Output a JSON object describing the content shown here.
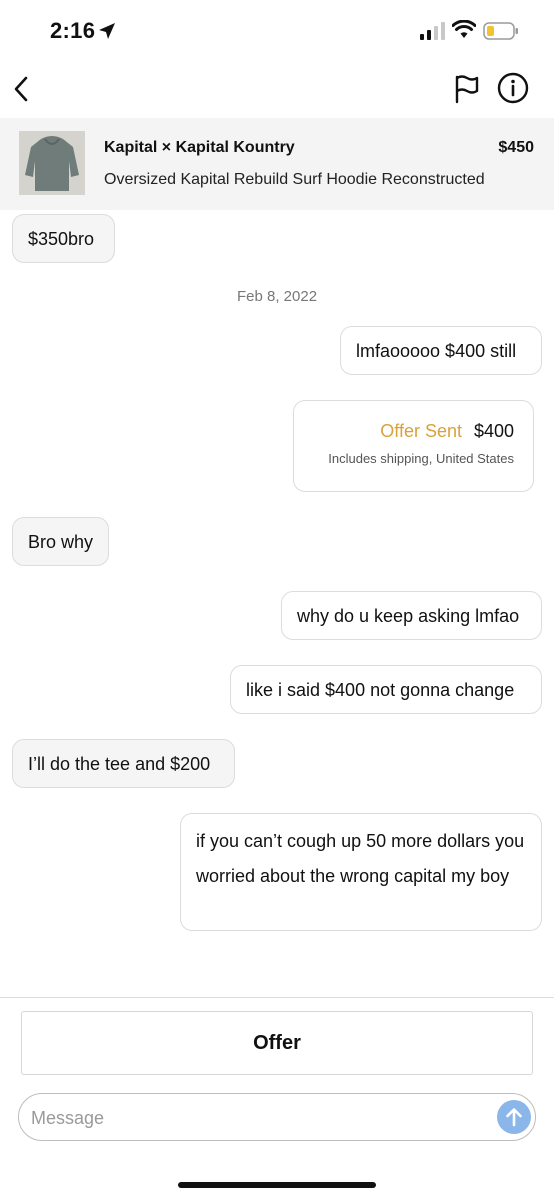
{
  "status_bar": {
    "time": "2:16",
    "icons": [
      "location-arrow-icon",
      "cellular-signal-icon",
      "wifi-icon",
      "battery-low-icon"
    ]
  },
  "nav": {
    "icons": [
      "back-chevron-icon",
      "flag-icon",
      "info-icon"
    ]
  },
  "listing": {
    "brand": "Kapital × Kapital Kountry",
    "price": "$450",
    "title": "Oversized Kapital Rebuild Surf Hoodie Reconstructed"
  },
  "conversation": {
    "messages": [
      {
        "sender": "them",
        "text": "$350bro"
      },
      {
        "sender": "me",
        "text": "lmfaooooo $400 still"
      },
      {
        "sender": "them",
        "text": "Bro why"
      },
      {
        "sender": "me",
        "text": "why do u keep asking lmfao"
      },
      {
        "sender": "me",
        "text": "like i said $400 not gonna change"
      },
      {
        "sender": "them",
        "text": "I’ll do the tee and $200"
      },
      {
        "sender": "me",
        "text": "if you can’t cough up 50 more dollars you worried about the wrong capital my boy"
      }
    ],
    "date_divider": "Feb 8, 2022",
    "offer": {
      "status": "Offer Sent",
      "amount": "$400",
      "details": "Includes shipping, United States"
    }
  },
  "composer": {
    "offer_label": "Offer",
    "message_placeholder": "Message",
    "message_value": "",
    "send_icon": "arrow-up-icon"
  },
  "colors": {
    "offer_status": "#d9a23a",
    "send_button": "#8ab6e9",
    "listing_background": "#f4f4f4"
  }
}
